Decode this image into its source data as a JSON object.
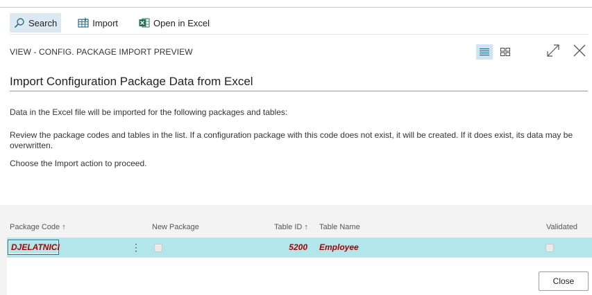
{
  "actions": {
    "search": {
      "label": "Search",
      "icon": "search-icon"
    },
    "import": {
      "label": "Import",
      "icon": "import-icon"
    },
    "open_excel": {
      "label": "Open in Excel",
      "icon": "excel-icon"
    }
  },
  "page": {
    "caption": "VIEW - CONFIG. PACKAGE IMPORT PREVIEW",
    "title": "Import Configuration Package Data from Excel",
    "instructions": [
      "Data in the Excel file will be imported for the following packages and tables:",
      "Review the package codes and tables in the list. If a configuration package with this code does not exist, it will be created. If it does exist, its data may be overwritten.",
      "Choose the Import action to proceed."
    ]
  },
  "grid": {
    "columns": {
      "package_code": "Package Code ↑",
      "new_package": "New Package",
      "table_id": "Table ID ↑",
      "table_name": "Table Name",
      "validated": "Validated"
    },
    "rows": [
      {
        "package_code": "DJELATNICI",
        "new_package": false,
        "table_id": "5200",
        "table_name": "Employee",
        "validated": false
      }
    ]
  },
  "footer": {
    "close_label": "Close"
  },
  "colors": {
    "accent": "#b2e6ea",
    "excel_green": "#1e7145",
    "value_red": "#a80000",
    "toggle_on": "#cfe3f3"
  }
}
